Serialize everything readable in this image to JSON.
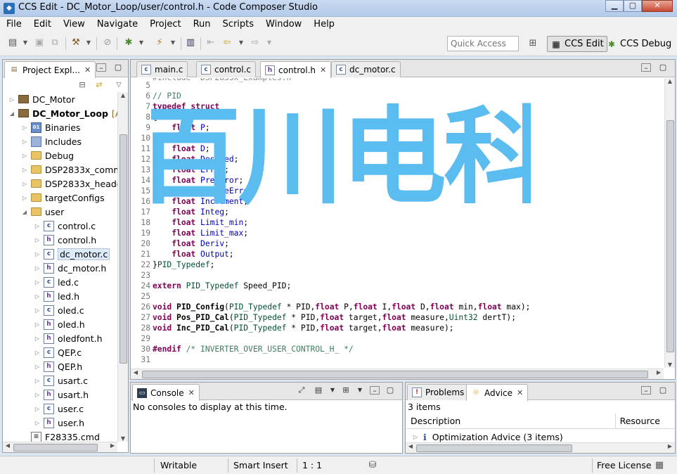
{
  "window": {
    "title": "CCS Edit - DC_Motor_Loop/user/control.h - Code Composer Studio"
  },
  "menu": [
    "File",
    "Edit",
    "View",
    "Navigate",
    "Project",
    "Run",
    "Scripts",
    "Window",
    "Help"
  ],
  "toolbar": {
    "quick_access_placeholder": "Quick Access",
    "perspectives": [
      {
        "label": "CCS Edit",
        "active": true
      },
      {
        "label": "CCS Debug",
        "active": false
      }
    ]
  },
  "project_explorer": {
    "tab_label": "Project Expl...",
    "tree": [
      {
        "label": "DC_Motor",
        "kind": "project",
        "level": 0,
        "expanded": false
      },
      {
        "label": "DC_Motor_Loop",
        "suffix": "[A",
        "kind": "project",
        "level": 0,
        "expanded": true,
        "bold": true
      },
      {
        "label": "Binaries",
        "kind": "bin",
        "level": 1,
        "expanded": false
      },
      {
        "label": "Includes",
        "kind": "inc",
        "level": 1,
        "expanded": false
      },
      {
        "label": "Debug",
        "kind": "folder",
        "level": 1,
        "expanded": false
      },
      {
        "label": "DSP2833x_comm",
        "kind": "folder",
        "level": 1,
        "expanded": false
      },
      {
        "label": "DSP2833x_heade",
        "kind": "folder",
        "level": 1,
        "expanded": false
      },
      {
        "label": "targetConfigs",
        "kind": "folder",
        "level": 1,
        "expanded": false
      },
      {
        "label": "user",
        "kind": "folder",
        "level": 1,
        "expanded": true
      },
      {
        "label": "control.c",
        "kind": "c",
        "level": 2
      },
      {
        "label": "control.h",
        "kind": "h",
        "level": 2
      },
      {
        "label": "dc_motor.c",
        "kind": "c",
        "level": 2,
        "selected": true
      },
      {
        "label": "dc_motor.h",
        "kind": "h",
        "level": 2
      },
      {
        "label": "led.c",
        "kind": "c",
        "level": 2
      },
      {
        "label": "led.h",
        "kind": "h",
        "level": 2
      },
      {
        "label": "oled.c",
        "kind": "c",
        "level": 2
      },
      {
        "label": "oled.h",
        "kind": "h",
        "level": 2
      },
      {
        "label": "oledfont.h",
        "kind": "h",
        "level": 2
      },
      {
        "label": "QEP.c",
        "kind": "c",
        "level": 2
      },
      {
        "label": "QEP.h",
        "kind": "h",
        "level": 2
      },
      {
        "label": "usart.c",
        "kind": "c",
        "level": 2
      },
      {
        "label": "usart.h",
        "kind": "h",
        "level": 2
      },
      {
        "label": "user.c",
        "kind": "c",
        "level": 2
      },
      {
        "label": "user.h",
        "kind": "h",
        "level": 2
      },
      {
        "label": "F28335.cmd",
        "kind": "cmd",
        "level": 1
      }
    ]
  },
  "editor": {
    "tabs": [
      {
        "label": "main.c",
        "kind": "c",
        "active": false
      },
      {
        "label": "control.c",
        "kind": "c",
        "active": false
      },
      {
        "label": "control.h",
        "kind": "h",
        "active": true
      },
      {
        "label": "dc_motor.c",
        "kind": "c",
        "active": false
      }
    ],
    "partial_top_line": "#include \"DSP2833x_Examples.h\"",
    "lines": [
      {
        "n": "5",
        "t": []
      },
      {
        "n": "6",
        "t": [
          [
            "cm",
            "// PID"
          ]
        ]
      },
      {
        "n": "7",
        "t": [
          [
            "kw",
            "typedef"
          ],
          [
            "",
            " "
          ],
          [
            "kw",
            "struct"
          ]
        ]
      },
      {
        "n": "8",
        "t": [
          [
            "",
            "{"
          ]
        ]
      },
      {
        "n": "9",
        "t": [
          [
            "",
            "    "
          ],
          [
            "kw",
            "float"
          ],
          [
            "",
            " "
          ],
          [
            "fld",
            "P"
          ],
          [
            "",
            ";"
          ]
        ]
      },
      {
        "n": "10",
        "t": [
          [
            "",
            "    "
          ],
          [
            "kw",
            "float"
          ],
          [
            "",
            " "
          ],
          [
            "fld",
            "I"
          ],
          [
            "",
            ";"
          ]
        ]
      },
      {
        "n": "11",
        "t": [
          [
            "",
            "    "
          ],
          [
            "kw",
            "float"
          ],
          [
            "",
            " "
          ],
          [
            "fld",
            "D"
          ],
          [
            "",
            ";"
          ]
        ]
      },
      {
        "n": "12",
        "t": [
          [
            "",
            "    "
          ],
          [
            "kw",
            "float"
          ],
          [
            "",
            " "
          ],
          [
            "fld",
            "Desired"
          ],
          [
            "",
            ";"
          ]
        ]
      },
      {
        "n": "13",
        "t": [
          [
            "",
            "    "
          ],
          [
            "kw",
            "float"
          ],
          [
            "",
            " "
          ],
          [
            "fld",
            "Error"
          ],
          [
            "",
            ";"
          ]
        ]
      },
      {
        "n": "14",
        "t": [
          [
            "",
            "    "
          ],
          [
            "kw",
            "float"
          ],
          [
            "",
            " "
          ],
          [
            "fld",
            "PreError"
          ],
          [
            "",
            ";"
          ]
        ]
      },
      {
        "n": "15",
        "t": [
          [
            "",
            "    "
          ],
          [
            "kw",
            "float"
          ],
          [
            "",
            " "
          ],
          [
            "fld",
            "PrePreError"
          ],
          [
            "",
            ";"
          ]
        ]
      },
      {
        "n": "16",
        "t": [
          [
            "",
            "    "
          ],
          [
            "kw",
            "float"
          ],
          [
            "",
            " "
          ],
          [
            "fld",
            "Increment"
          ],
          [
            "",
            ";"
          ]
        ]
      },
      {
        "n": "17",
        "t": [
          [
            "",
            "    "
          ],
          [
            "kw",
            "float"
          ],
          [
            "",
            " "
          ],
          [
            "fld",
            "Integ"
          ],
          [
            "",
            ";"
          ]
        ]
      },
      {
        "n": "18",
        "t": [
          [
            "",
            "    "
          ],
          [
            "kw",
            "float"
          ],
          [
            "",
            " "
          ],
          [
            "fld",
            "Limit_min"
          ],
          [
            "",
            ";"
          ]
        ]
      },
      {
        "n": "19",
        "t": [
          [
            "",
            "    "
          ],
          [
            "kw",
            "float"
          ],
          [
            "",
            " "
          ],
          [
            "fld",
            "Limit_max"
          ],
          [
            "",
            ";"
          ]
        ]
      },
      {
        "n": "20",
        "t": [
          [
            "",
            "    "
          ],
          [
            "kw",
            "float"
          ],
          [
            "",
            " "
          ],
          [
            "fld",
            "Deriv"
          ],
          [
            "",
            ";"
          ]
        ]
      },
      {
        "n": "21",
        "t": [
          [
            "",
            "    "
          ],
          [
            "kw",
            "float"
          ],
          [
            "",
            " "
          ],
          [
            "fld",
            "Output"
          ],
          [
            "",
            ";"
          ]
        ]
      },
      {
        "n": "22",
        "t": [
          [
            "",
            "}"
          ],
          [
            "ty",
            "PID_Typedef"
          ],
          [
            "",
            ";"
          ]
        ]
      },
      {
        "n": "23",
        "t": []
      },
      {
        "n": "24",
        "t": [
          [
            "kw",
            "extern"
          ],
          [
            "",
            " "
          ],
          [
            "ty",
            "PID_Typedef"
          ],
          [
            "",
            " Speed_PID;"
          ]
        ]
      },
      {
        "n": "25",
        "t": []
      },
      {
        "n": "26",
        "t": [
          [
            "kw",
            "void"
          ],
          [
            "",
            " "
          ],
          [
            "fn",
            "PID_Config"
          ],
          [
            "",
            "("
          ],
          [
            "ty",
            "PID_Typedef"
          ],
          [
            "",
            " * PID,"
          ],
          [
            "kw",
            "float"
          ],
          [
            "",
            " P,"
          ],
          [
            "kw",
            "float"
          ],
          [
            "",
            " I,"
          ],
          [
            "kw",
            "float"
          ],
          [
            "",
            " D,"
          ],
          [
            "kw",
            "float"
          ],
          [
            "",
            " min,"
          ],
          [
            "kw",
            "float"
          ],
          [
            "",
            " max);"
          ]
        ]
      },
      {
        "n": "27",
        "t": [
          [
            "kw",
            "void"
          ],
          [
            "",
            " "
          ],
          [
            "fn",
            "Pos_PID_Cal"
          ],
          [
            "",
            "("
          ],
          [
            "ty",
            "PID_Typedef"
          ],
          [
            "",
            " * PID,"
          ],
          [
            "kw",
            "float"
          ],
          [
            "",
            " target,"
          ],
          [
            "kw",
            "float"
          ],
          [
            "",
            " measure,"
          ],
          [
            "ty",
            "Uint32"
          ],
          [
            "",
            " dertT);"
          ]
        ]
      },
      {
        "n": "28",
        "t": [
          [
            "kw",
            "void"
          ],
          [
            "",
            " "
          ],
          [
            "fn",
            "Inc_PID_Cal"
          ],
          [
            "",
            "("
          ],
          [
            "ty",
            "PID_Typedef"
          ],
          [
            "",
            " * PID,"
          ],
          [
            "kw",
            "float"
          ],
          [
            "",
            " target,"
          ],
          [
            "kw",
            "float"
          ],
          [
            "",
            " measure);"
          ]
        ]
      },
      {
        "n": "29",
        "t": []
      },
      {
        "n": "30",
        "t": [
          [
            "pp",
            "#endif"
          ],
          [
            "",
            " "
          ],
          [
            "cm",
            "/* INVERTER_OVER_USER_CONTROL_H_ */"
          ]
        ]
      },
      {
        "n": "31",
        "t": []
      }
    ]
  },
  "watermark": {
    "text": "百川电科",
    "color": "#5bbcf0"
  },
  "console": {
    "tab_label": "Console",
    "message": "No consoles to display at this time."
  },
  "problems": {
    "tab_label": "Problems",
    "advice_tab_label": "Advice",
    "count": "3 items",
    "columns": [
      "Description",
      "Resource"
    ],
    "rows": [
      {
        "label": "Optimization Advice (3 items)"
      }
    ]
  },
  "status": {
    "writable": "Writable",
    "insert": "Smart Insert",
    "position": "1 : 1",
    "license": "Free License"
  }
}
